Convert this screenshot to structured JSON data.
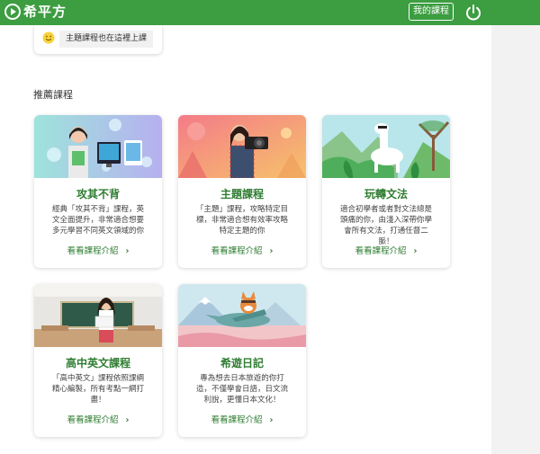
{
  "header": {
    "logo_text": "希平方",
    "my_courses_label": "我的課程",
    "brand_color": "#3c9d41"
  },
  "top_card": {
    "button_label": "主題課程也在這裡上課"
  },
  "recommended": {
    "title": "推薦課程",
    "link_label": "看看課程介紹",
    "cards": [
      {
        "title": "攻其不背",
        "desc": "經典「攻其不背」課程，英文全面提升，非常適合想要多元學習不同英文領域的你"
      },
      {
        "title": "主題課程",
        "desc": "「主題」課程，攻略特定目標，非常適合想有效率攻略特定主題的你"
      },
      {
        "title": "玩轉文法",
        "desc": "適合初學者或者對文法總是頭痛的你，由淺入深帶你學會所有文法，打通任督二脈！"
      },
      {
        "title": "高中英文課程",
        "desc": "「高中英文」課程依照課綱精心編製，所有考點一網打盡！"
      },
      {
        "title": "希遊日記",
        "desc": "專為想去日本旅遊的你打造，不僅學會日語，日文流利說，更懂日本文化！"
      }
    ]
  }
}
